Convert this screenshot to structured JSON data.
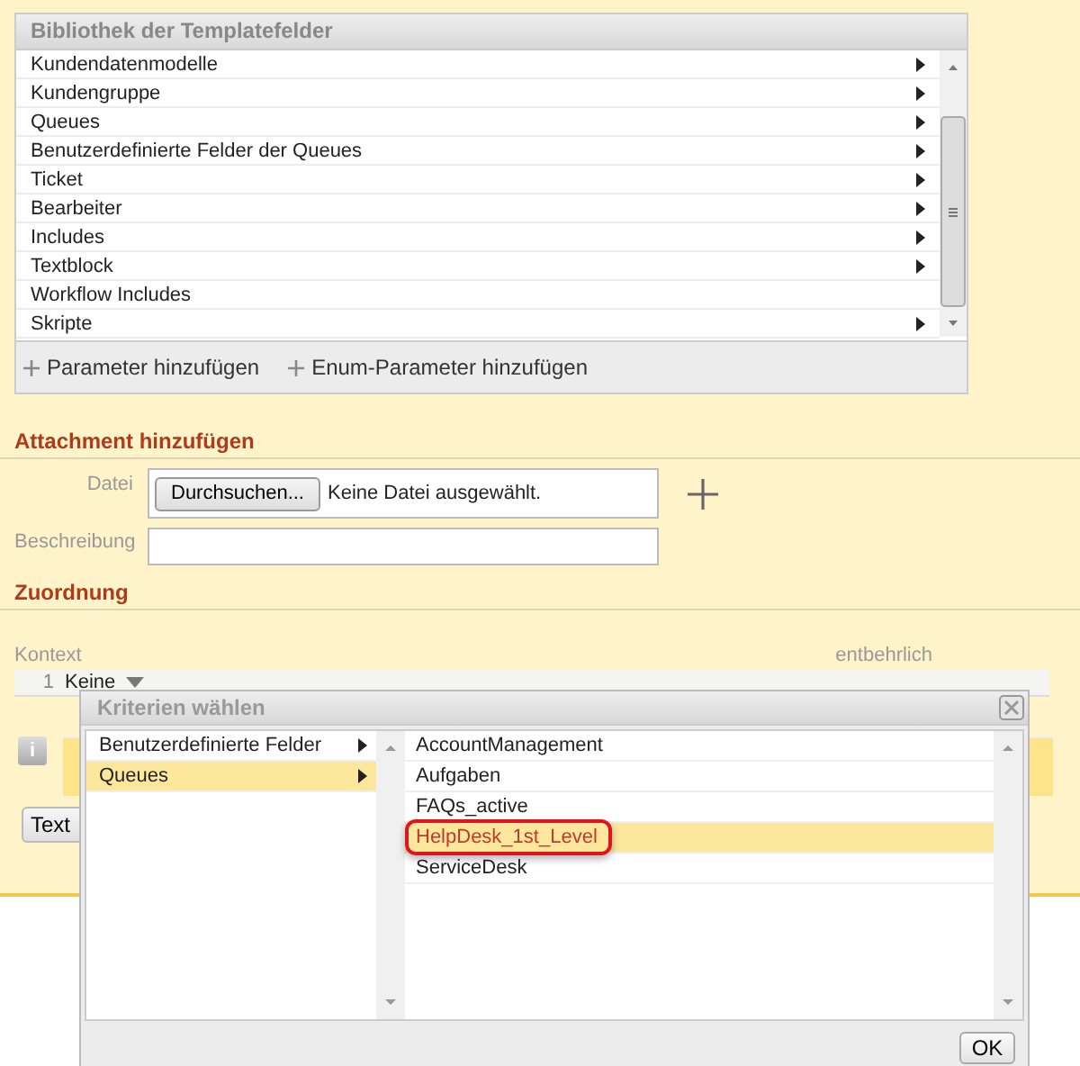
{
  "library": {
    "title": "Bibliothek der Templatefelder",
    "items": [
      {
        "label": "Kundendatenmodelle",
        "has_submenu": true
      },
      {
        "label": "Kundengruppe",
        "has_submenu": true
      },
      {
        "label": "Queues",
        "has_submenu": true
      },
      {
        "label": "Benutzerdefinierte Felder der Queues",
        "has_submenu": true
      },
      {
        "label": "Ticket",
        "has_submenu": true
      },
      {
        "label": "Bearbeiter",
        "has_submenu": true
      },
      {
        "label": "Includes",
        "has_submenu": true
      },
      {
        "label": "Textblock",
        "has_submenu": true
      },
      {
        "label": "Workflow Includes",
        "has_submenu": false
      },
      {
        "label": "Skripte",
        "has_submenu": true
      }
    ],
    "actions": [
      "Parameter hinzufügen",
      "Enum-Parameter hinzufügen"
    ]
  },
  "attachment": {
    "heading": "Attachment hinzufügen",
    "file_label": "Datei",
    "browse_button": "Durchsuchen...",
    "file_status": "Keine Datei ausgewählt.",
    "description_label": "Beschreibung"
  },
  "assignment": {
    "heading": "Zuordnung",
    "context_label": "Kontext",
    "optional_label": "entbehrlich",
    "row_number": "1",
    "context_value": "Keine",
    "info_icon": "i",
    "partial_button": "Text"
  },
  "dialog": {
    "title": "Kriterien wählen",
    "categories": [
      {
        "label": "Benutzerdefinierte Felder",
        "selected": false
      },
      {
        "label": "Queues",
        "selected": true
      }
    ],
    "queues": [
      {
        "label": "AccountManagement",
        "selected": false,
        "highlighted": false
      },
      {
        "label": "Aufgaben",
        "selected": false,
        "highlighted": false
      },
      {
        "label": "FAQs_active",
        "selected": false,
        "highlighted": false
      },
      {
        "label": "HelpDesk_1st_Level",
        "selected": true,
        "highlighted": true
      },
      {
        "label": "ServiceDesk",
        "selected": false,
        "highlighted": false
      }
    ],
    "ok_button": "OK"
  }
}
